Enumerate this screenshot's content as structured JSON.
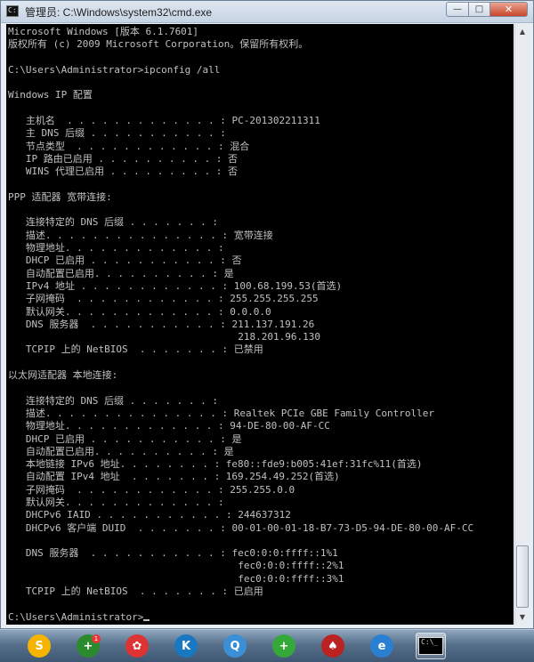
{
  "window": {
    "title": "管理员: C:\\Windows\\system32\\cmd.exe",
    "icon": "cmd-icon",
    "controls": {
      "minimize": "—",
      "maximize": "□",
      "close": "✕"
    }
  },
  "console": {
    "lines": [
      "Microsoft Windows [版本 6.1.7601]",
      "版权所有 (c) 2009 Microsoft Corporation。保留所有权利。",
      "",
      "C:\\Users\\Administrator>ipconfig /all",
      "",
      "Windows IP 配置",
      "",
      "   主机名  . . . . . . . . . . . . . : PC-201302211311",
      "   主 DNS 后缀 . . . . . . . . . . . :",
      "   节点类型  . . . . . . . . . . . . : 混合",
      "   IP 路由已启用 . . . . . . . . . . : 否",
      "   WINS 代理已启用 . . . . . . . . . : 否",
      "",
      "PPP 适配器 宽带连接:",
      "",
      "   连接特定的 DNS 后缀 . . . . . . . :",
      "   描述. . . . . . . . . . . . . . . : 宽带连接",
      "   物理地址. . . . . . . . . . . . . :",
      "   DHCP 已启用 . . . . . . . . . . . : 否",
      "   自动配置已启用. . . . . . . . . . : 是",
      "   IPv4 地址 . . . . . . . . . . . . : 100.68.199.53(首选)",
      "   子网掩码  . . . . . . . . . . . . : 255.255.255.255",
      "   默认网关. . . . . . . . . . . . . : 0.0.0.0",
      "   DNS 服务器  . . . . . . . . . . . : 211.137.191.26",
      "                                       218.201.96.130",
      "   TCPIP 上的 NetBIOS  . . . . . . . : 已禁用",
      "",
      "以太网适配器 本地连接:",
      "",
      "   连接特定的 DNS 后缀 . . . . . . . :",
      "   描述. . . . . . . . . . . . . . . : Realtek PCIe GBE Family Controller",
      "   物理地址. . . . . . . . . . . . . : 94-DE-80-00-AF-CC",
      "   DHCP 已启用 . . . . . . . . . . . : 是",
      "   自动配置已启用. . . . . . . . . . : 是",
      "   本地链接 IPv6 地址. . . . . . . . : fe80::fde9:b005:41ef:31fc%11(首选)",
      "   自动配置 IPv4 地址  . . . . . . . : 169.254.49.252(首选)",
      "   子网掩码  . . . . . . . . . . . . : 255.255.0.0",
      "   默认网关. . . . . . . . . . . . . :",
      "   DHCPv6 IAID . . . . . . . . . . . : 244637312",
      "   DHCPv6 客户端 DUID  . . . . . . . : 00-01-00-01-18-B7-73-D5-94-DE-80-00-AF-CC",
      "",
      "   DNS 服务器  . . . . . . . . . . . : fec0:0:0:ffff::1%1",
      "                                       fec0:0:0:ffff::2%1",
      "                                       fec0:0:0:ffff::3%1",
      "   TCPIP 上的 NetBIOS  . . . . . . . : 已启用",
      "",
      "C:\\Users\\Administrator>"
    ]
  },
  "scrollbar": {
    "up_icon": "▲",
    "down_icon": "▼"
  },
  "taskbar": {
    "items": [
      {
        "name": "qq-browser",
        "icon": "S",
        "color": "#f4b400"
      },
      {
        "name": "360-security",
        "icon": "+",
        "color": "#2b8a2b",
        "badge": "1"
      },
      {
        "name": "colorful-app",
        "icon": "✿",
        "color": "#d33"
      },
      {
        "name": "k-app",
        "icon": "K",
        "color": "#1a78c2"
      },
      {
        "name": "qq-chat",
        "icon": "Q",
        "color": "#3a8fd6"
      },
      {
        "name": "green-plus",
        "icon": "+",
        "color": "#35a83a"
      },
      {
        "name": "cards-game",
        "icon": "♠",
        "color": "#b22"
      },
      {
        "name": "internet-explorer",
        "icon": "e",
        "color": "#2a7fd0"
      },
      {
        "name": "cmd",
        "icon": "C:\\_",
        "color": "#000"
      }
    ],
    "accent": "#56708b"
  }
}
